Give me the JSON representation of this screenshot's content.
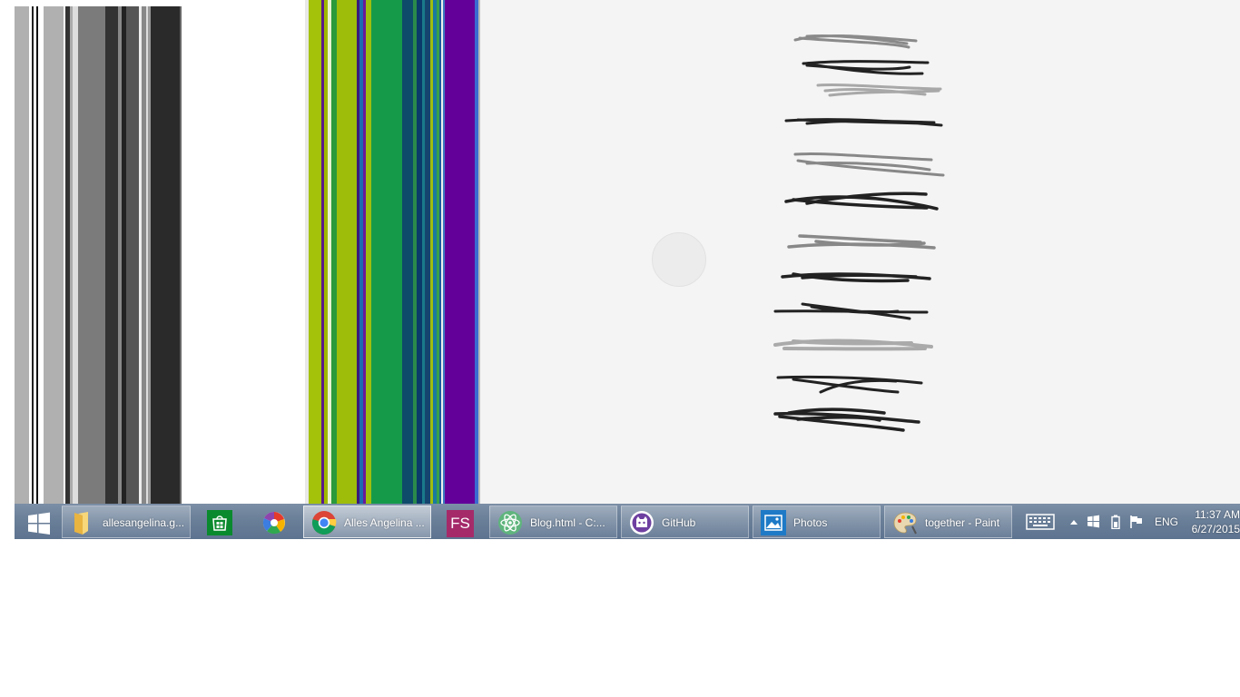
{
  "taskbar": {
    "start_icon": "windows-logo-icon",
    "items": [
      {
        "label": "allesangelina.g...",
        "icon": "folder-icon",
        "style": "button"
      },
      {
        "label": "",
        "icon": "store-icon",
        "style": "plain"
      },
      {
        "label": "",
        "icon": "picasa-icon",
        "style": "plain"
      },
      {
        "label": "Alles Angelina ...",
        "icon": "chrome-icon",
        "style": "active"
      },
      {
        "label": "",
        "icon": "fs-icon",
        "style": "plain"
      },
      {
        "label": "Blog.html - C:...",
        "icon": "atom-icon",
        "style": "button"
      },
      {
        "label": "GitHub",
        "icon": "github-icon",
        "style": "button"
      },
      {
        "label": "Photos",
        "icon": "photos-icon",
        "style": "button"
      },
      {
        "label": "together - Paint",
        "icon": "paint-icon",
        "style": "button"
      }
    ],
    "fs_label": "FS",
    "tray": {
      "language": "ENG",
      "time": "11:37 AM",
      "date": "6/27/2015",
      "icons": [
        "keyboard-icon",
        "show-hidden-icons-icon",
        "windows-small-icon",
        "battery-icon",
        "action-center-flag-icon"
      ]
    }
  },
  "colors": {
    "canvas": "#f4f4f4",
    "taskbar": "#6a7f98",
    "fs_tile": "#a52a6a",
    "store_tile": "#0a8a2e"
  }
}
